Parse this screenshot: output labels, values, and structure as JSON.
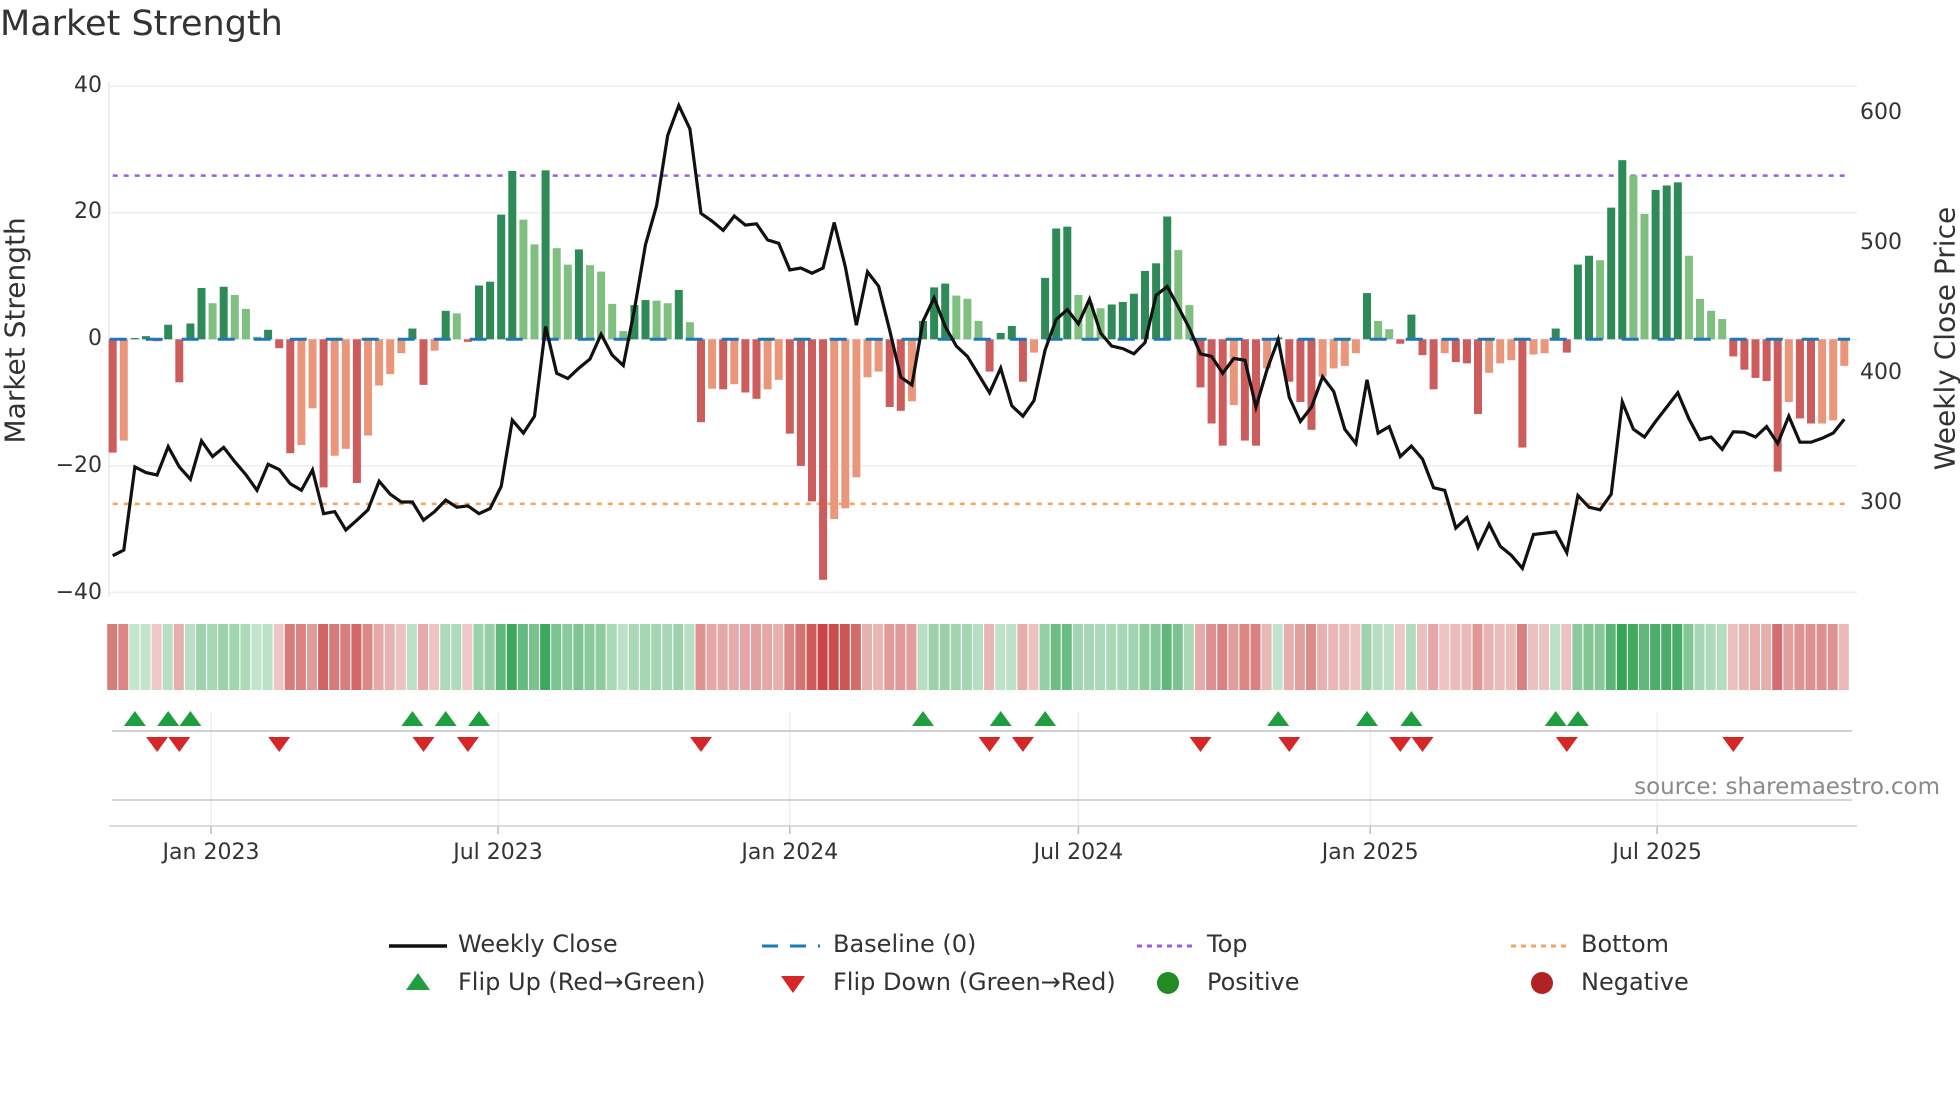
{
  "title": "Market Strength",
  "source": "source: sharemaestro.com",
  "colors": {
    "bar_up_strong": "#2e8b57",
    "bar_up_weak": "#7fbf7f",
    "bar_down_strong": "#cd5c5c",
    "bar_down_weak": "#e9967a",
    "close_line": "#111111",
    "baseline": "#1f77b4",
    "top": "#9b5de5",
    "bottom": "#f4a460",
    "flip_up": "#1f9e3f",
    "flip_down": "#d62728",
    "positive": "#228b22",
    "negative": "#b22222"
  },
  "chart_data": {
    "type": "bar",
    "title": "Market Strength",
    "ylabel": "Market Strength",
    "y2label": "Weekly Close Price",
    "ylim": [
      -40,
      40
    ],
    "y_ticks": [
      {
        "value": 40,
        "label": "40"
      },
      {
        "value": 20,
        "label": "20"
      },
      {
        "value": 0,
        "label": "0"
      },
      {
        "value": -20,
        "label": "−20"
      },
      {
        "value": -40,
        "label": "−40"
      }
    ],
    "y2_ticks": [
      {
        "value": 600,
        "label": "600"
      },
      {
        "value": 500,
        "label": "500"
      },
      {
        "value": 400,
        "label": "400"
      },
      {
        "value": 300,
        "label": "300"
      }
    ],
    "x_start": "2022-10-31",
    "x_frequency": "weekly",
    "x_ticks": [
      {
        "label": "Jan 2023",
        "date": "2023-01-01"
      },
      {
        "label": "Jul 2023",
        "date": "2023-07-01"
      },
      {
        "label": "Jan 2024",
        "date": "2024-01-01"
      },
      {
        "label": "Jul 2024",
        "date": "2024-07-01"
      },
      {
        "label": "Jan 2025",
        "date": "2025-01-01"
      },
      {
        "label": "Jul 2025",
        "date": "2025-07-01"
      }
    ],
    "top": 25.85,
    "bottom": -26,
    "baseline": 0,
    "series": [
      {
        "name": "Market Strength",
        "values": [
          -17.9,
          -16,
          0.2,
          0.5,
          -0.3,
          2.3,
          -6.8,
          2.5,
          8.1,
          5.7,
          8.3,
          7,
          4.8,
          0.4,
          1.5,
          -1.4,
          -18,
          -16.7,
          -10.9,
          -23.4,
          -18.4,
          -17.3,
          -22.7,
          -15.2,
          -7.3,
          -5.5,
          -2.2,
          1.7,
          -7.2,
          -1.8,
          4.5,
          4.1,
          -0.4,
          8.5,
          9.1,
          19.7,
          26.6,
          18.9,
          15,
          26.7,
          14.4,
          11.8,
          14.2,
          11.7,
          10.7,
          5.6,
          1.3,
          5.4,
          6.2,
          6.1,
          5.7,
          7.8,
          2.7,
          -13.1,
          -7.8,
          -7.9,
          -7.1,
          -8.4,
          -9.4,
          -7.9,
          -6.4,
          -14.9,
          -20,
          -25.6,
          -38,
          -28.4,
          -26.7,
          -21.8,
          -6,
          -5.1,
          -10.7,
          -11.3,
          -9.8,
          2.9,
          8.2,
          8.8,
          6.9,
          6.4,
          2.9,
          -5.1,
          1,
          2.1,
          -6.7,
          -2.1,
          9.7,
          17.5,
          17.8,
          7,
          5.7,
          4.9,
          5.5,
          5.9,
          7.2,
          10.8,
          12,
          19.4,
          14.1,
          5.4,
          -7.6,
          -13.3,
          -16.8,
          -10.4,
          -16,
          -16.8,
          -4.6,
          0.3,
          -6.7,
          -9.9,
          -14.3,
          -5.9,
          -4.6,
          -4.2,
          -2.2,
          7.3,
          2.9,
          1.6,
          -0.7,
          3.9,
          -2.5,
          -7.9,
          -2.2,
          -3.6,
          -3.8,
          -11.8,
          -5.3,
          -3.8,
          -3.3,
          -17.1,
          -2.4,
          -2.2,
          1.7,
          -2.1,
          11.8,
          13.2,
          12.5,
          20.8,
          28.3,
          25.9,
          19.8,
          23.6,
          24.3,
          24.8,
          13.2,
          6.4,
          4.5,
          3.2,
          -2.7,
          -4.8,
          -6.1,
          -6.6,
          -20.9,
          -9.9,
          -12.5,
          -13.3,
          -13.3,
          -12.8,
          -4.2
        ]
      },
      {
        "name": "Weekly Close",
        "axis": "right",
        "values": [
          259.7,
          264,
          328,
          323.6,
          321.8,
          343.6,
          328,
          318.5,
          348,
          336,
          343,
          332,
          322,
          310,
          330,
          326,
          315,
          310,
          325.6,
          292,
          293.6,
          279.5,
          287,
          295,
          317,
          307,
          301,
          301,
          287,
          293.6,
          302.5,
          297,
          298,
          292,
          296,
          313,
          364,
          354,
          367,
          436,
          400,
          396,
          404,
          411,
          430,
          414,
          406,
          449,
          499,
          529,
          583,
          606,
          588,
          523,
          517,
          510,
          521,
          514,
          515,
          502.6,
          500,
          479.5,
          481,
          477,
          481,
          516,
          482,
          437,
          478,
          467,
          433,
          397,
          391,
          440,
          458,
          436,
          421,
          413,
          399,
          385,
          404,
          375,
          367,
          379,
          418,
          441.5,
          449,
          438,
          457,
          431,
          421,
          419,
          415,
          423.6,
          460,
          466.7,
          451,
          434.6,
          415,
          413,
          400,
          411.5,
          410,
          374,
          403,
          426,
          381.5,
          363,
          374,
          397.4,
          386,
          357,
          346,
          395,
          354,
          359,
          336,
          344,
          334,
          312,
          310,
          281,
          289,
          266,
          284,
          267,
          260,
          250,
          276,
          277,
          278,
          262,
          306,
          297,
          295,
          307,
          378,
          357,
          351,
          363,
          374,
          385,
          365,
          349,
          351,
          341.5,
          355,
          354.6,
          351,
          359,
          346,
          367,
          347,
          347,
          350,
          354,
          364.6
        ]
      }
    ],
    "flip_up_weeks": [
      2,
      5,
      7,
      27,
      30,
      33,
      73,
      80,
      84,
      105,
      113,
      117,
      130,
      132
    ],
    "flip_down_weeks": [
      4,
      6,
      15,
      28,
      32,
      53,
      79,
      82,
      98,
      106,
      116,
      118,
      131,
      146
    ],
    "legend_position": "bottom",
    "legend": [
      {
        "label": "Weekly Close",
        "symbol": "line"
      },
      {
        "label": "Baseline (0)",
        "symbol": "dash"
      },
      {
        "label": "Top",
        "symbol": "dot"
      },
      {
        "label": "Bottom",
        "symbol": "dot"
      },
      {
        "label": "Flip Up (Red→Green)",
        "symbol": "triangle-up"
      },
      {
        "label": "Flip Down (Green→Red)",
        "symbol": "triangle-down"
      },
      {
        "label": "Positive",
        "symbol": "circle"
      },
      {
        "label": "Negative",
        "symbol": "circle"
      }
    ]
  }
}
